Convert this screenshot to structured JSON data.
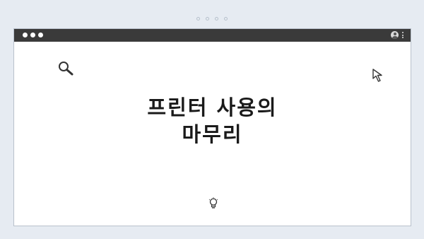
{
  "title": {
    "line1": "프린터 사용의",
    "line2": "마무리"
  },
  "icons": {
    "search": "search-icon",
    "cursor": "cursor-icon",
    "lightbulb": "lightbulb-icon",
    "profile": "profile-icon",
    "menu": "kebab-menu-icon"
  },
  "colors": {
    "background": "#e6ebf2",
    "titlebar": "#3a3a3a",
    "window": "#ffffff",
    "text": "#1a1a1a"
  }
}
